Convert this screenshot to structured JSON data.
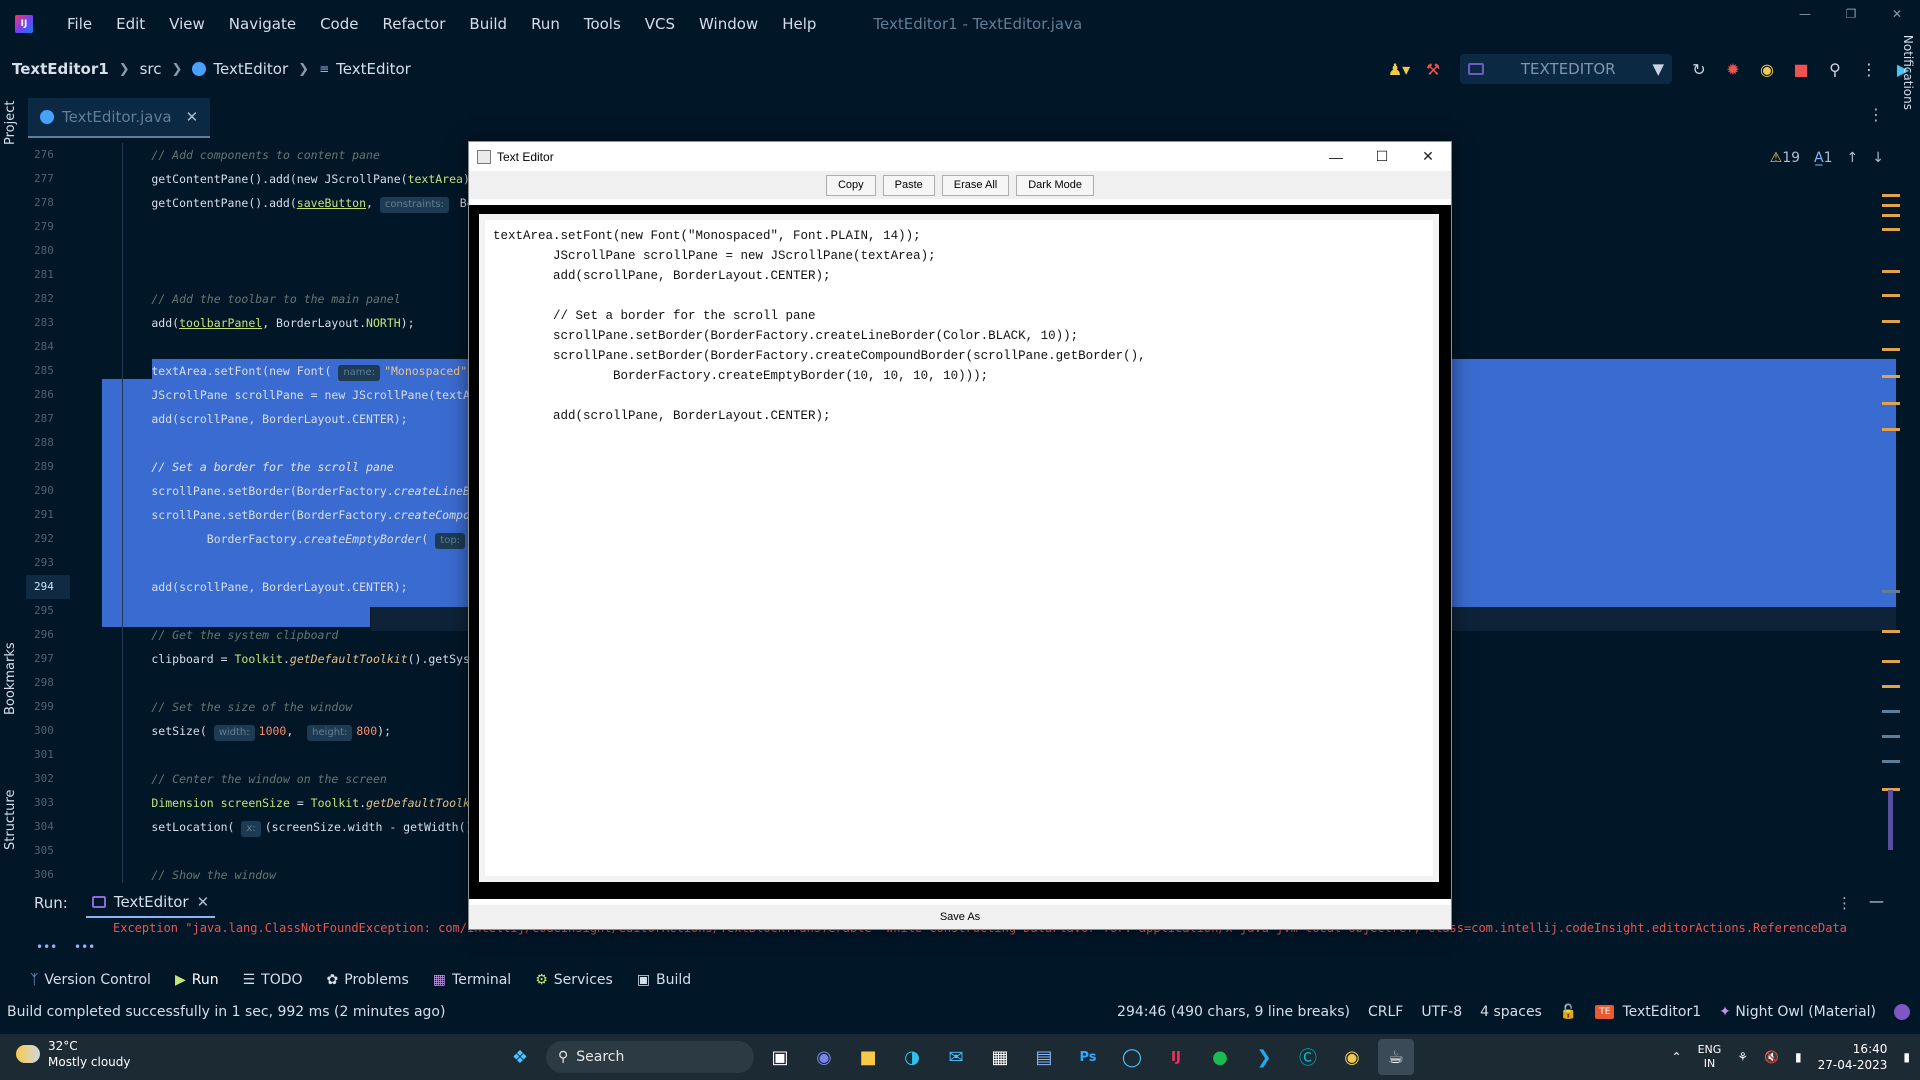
{
  "menubar": {
    "items": [
      "File",
      "Edit",
      "View",
      "Navigate",
      "Code",
      "Refactor",
      "Build",
      "Run",
      "Tools",
      "VCS",
      "Window",
      "Help"
    ],
    "window_title": "TextEditor1 - TextEditor.java"
  },
  "navbar": {
    "project": "TextEditor1",
    "src": "src",
    "class1": "TextEditor",
    "class2": "TextEditor",
    "run_config": "TEXTEDITOR"
  },
  "left_strip": {
    "project": "Project",
    "bookmarks": "Bookmarks",
    "structure": "Structure"
  },
  "right_strip": {
    "notifications": "Notifications"
  },
  "tab": {
    "label": "TextEditor.java"
  },
  "editor_info": {
    "warnings": "19",
    "typos": "1"
  },
  "editor": {
    "line_numbers": [
      "276",
      "277",
      "278",
      "279",
      "280",
      "281",
      "282",
      "283",
      "284",
      "285",
      "286",
      "287",
      "288",
      "289",
      "290",
      "291",
      "292",
      "293",
      "294",
      "295",
      "296",
      "297",
      "298",
      "299",
      "300",
      "301",
      "302",
      "303",
      "304",
      "305",
      "306"
    ],
    "current_line": "294"
  },
  "run_panel": {
    "label": "Run:",
    "tab": "TextEditor",
    "output": "Exception \"java.lang.ClassNotFoundException: com/intellij/codeInsight/editorActions/TextBlockTransferable\" while constructing DataFlavor for: application/x-java-jvm-local-objectref; class=com.intellij.codeInsight.editorActions.ReferenceData"
  },
  "tool_windows": [
    "Version Control",
    "Run",
    "TODO",
    "Problems",
    "Terminal",
    "Services",
    "Build"
  ],
  "statusbar": {
    "message": "Build completed successfully in 1 sec, 992 ms (2 minutes ago)",
    "position": "294:46 (490 chars, 9 line breaks)",
    "line_sep": "CRLF",
    "encoding": "UTF-8",
    "indent": "4 spaces",
    "project_badge": "TE",
    "project": "TextEditor1",
    "theme": "Night Owl (Material)"
  },
  "dialog": {
    "title": "Text Editor",
    "buttons": [
      "Copy",
      "Paste",
      "Erase All",
      "Dark Mode"
    ],
    "content": "textArea.setFont(new Font(\"Monospaced\", Font.PLAIN, 14));\n        JScrollPane scrollPane = new JScrollPane(textArea);\n        add(scrollPane, BorderLayout.CENTER);\n\n        // Set a border for the scroll pane\n        scrollPane.setBorder(BorderFactory.createLineBorder(Color.BLACK, 10));\n        scrollPane.setBorder(BorderFactory.createCompoundBorder(scrollPane.getBorder(),\n                BorderFactory.createEmptyBorder(10, 10, 10, 10)));\n\n        add(scrollPane, BorderLayout.CENTER);",
    "save_as": "Save As"
  },
  "taskbar": {
    "temp": "32°C",
    "weather": "Mostly cloudy",
    "search": "Search",
    "lang1": "ENG",
    "lang2": "IN",
    "time": "16:40",
    "date": "27-04-2023"
  }
}
